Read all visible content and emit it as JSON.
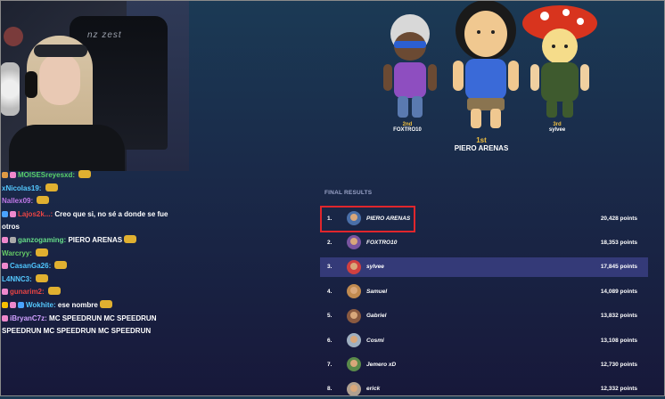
{
  "chat": [
    {
      "user": "MOISESreyesxd:",
      "color": "#59d16b",
      "text": "",
      "badges": [
        "#d94",
        "#e8c"
      ],
      "emote": true
    },
    {
      "user": "xNicolas19:",
      "color": "#55c9ff",
      "text": "",
      "badges": [],
      "emote": true
    },
    {
      "user": "Nallex09:",
      "color": "#c078e8",
      "text": "",
      "badges": [],
      "emote": true
    },
    {
      "user": "Lajos2k...:",
      "color": "#e94444",
      "text": "Creo que si, no sé a donde se fue",
      "badges": [
        "#4aa3ff",
        "#e8c"
      ],
      "emote": false
    },
    {
      "user": "",
      "color": "#fff",
      "text": "otros",
      "badges": [],
      "emote": false
    },
    {
      "user": "ganzogaming:",
      "color": "#66dd88",
      "text": "PIERO ARENAS",
      "badges": [
        "#e8c",
        "#aaa"
      ],
      "emote": true
    },
    {
      "user": "Warcryy:",
      "color": "#66cc66",
      "text": "",
      "badges": [],
      "emote": true
    },
    {
      "user": "CasanGa26:",
      "color": "#4fc6ff",
      "text": "",
      "badges": [
        "#e8c"
      ],
      "emote": true
    },
    {
      "user": "L4NNC3:",
      "color": "#55c9ff",
      "text": "",
      "badges": [],
      "emote": true
    },
    {
      "user": "gunarim2:",
      "color": "#e94444",
      "text": "",
      "badges": [
        "#e8c"
      ],
      "emote": true
    },
    {
      "user": "Wokhite:",
      "color": "#55c9ff",
      "text": "ese nombre",
      "badges": [
        "#f5c000",
        "#e8c",
        "#4aa3ff"
      ],
      "emote": true
    },
    {
      "user": "iBryanC7z:",
      "color": "#d0a0ff",
      "text": "MC SPEEDRUN  MC SPEEDRUN",
      "badges": [
        "#e8c"
      ],
      "emote": false
    },
    {
      "user": "",
      "color": "#fff",
      "text": "SPEEDRUN  MC SPEEDRUN  MC SPEEDRUN",
      "badges": [],
      "emote": false
    }
  ],
  "podium": {
    "first": {
      "rank": "1st",
      "name": "PIERO ARENAS"
    },
    "second": {
      "rank": "2nd",
      "name": "FOXTRO10"
    },
    "third": {
      "rank": "3rd",
      "name": "sylvee"
    }
  },
  "results": {
    "title": "FINAL RESULTS",
    "rows": [
      {
        "rank": "1.",
        "name": "PIERO ARENAS",
        "points": "20,428 points",
        "avatar": "#4a6fa8"
      },
      {
        "rank": "2.",
        "name": "FOXTRO10",
        "points": "18,353 points",
        "avatar": "#7a55a0"
      },
      {
        "rank": "3.",
        "name": "sylvee",
        "points": "17,845 points",
        "avatar": "#d04040"
      },
      {
        "rank": "4.",
        "name": "Samuel",
        "points": "14,089 points",
        "avatar": "#c08a50"
      },
      {
        "rank": "5.",
        "name": "Gabriel",
        "points": "13,832 points",
        "avatar": "#8a5a40"
      },
      {
        "rank": "6.",
        "name": "Cosmi",
        "points": "13,108 points",
        "avatar": "#a0b0c0"
      },
      {
        "rank": "7.",
        "name": "Jemero xD",
        "points": "12,730 points",
        "avatar": "#5a8a4a"
      },
      {
        "rank": "8.",
        "name": "erick",
        "points": "12,332 points",
        "avatar": "#b0a090"
      }
    ]
  },
  "colors": {
    "highlight_row": "#343a78",
    "selection_box": "#e0262c",
    "gold": "#f0c040"
  }
}
